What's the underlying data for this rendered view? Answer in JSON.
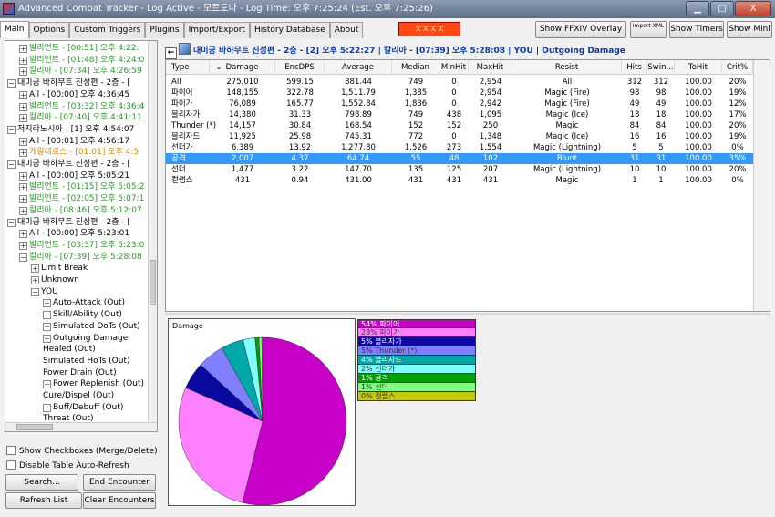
{
  "window": {
    "title": "Advanced Combat Tracker - Log Active - 모르도나 - Log Time: 오후 7:25:24 (Est. 오후 7:25:26)",
    "min": "▁",
    "max": "□",
    "close": "X"
  },
  "tabs": [
    "Main",
    "Options",
    "Custom Triggers",
    "Plugins",
    "Import/Export",
    "History Database",
    "About"
  ],
  "alert_text": "ㅈㅈㅈㅈ",
  "toolbar": {
    "overlay": "Show FFXIV Overlay",
    "import": "Import XML",
    "timers": "Show Timers",
    "mini": "Show Mini"
  },
  "tree": [
    {
      "text": "발리언트 - [00:51] 오후 4:22:",
      "cls": "g",
      "ind": 1,
      "box": "+"
    },
    {
      "text": "발리언트 - [01:48] 오후 4:24:0",
      "cls": "g",
      "ind": 1,
      "box": "+"
    },
    {
      "text": "칼리아 - [07:34] 오후 4:26:59",
      "cls": "g",
      "ind": 1,
      "box": "+"
    },
    {
      "text": "대미궁 바하무트 진성편 - 2층 - [",
      "cls": "",
      "ind": 0,
      "box": "−"
    },
    {
      "text": "All - [00:00] 오후 4:36:45",
      "cls": "",
      "ind": 1,
      "box": "+"
    },
    {
      "text": "발리언트 - [03:32] 오후 4:36:4",
      "cls": "g",
      "ind": 1,
      "box": "+"
    },
    {
      "text": "칼리아 - [07:40] 오후 4:41:11",
      "cls": "g",
      "ind": 1,
      "box": "+"
    },
    {
      "text": "저지라노시아 - [1] 오후 4:54:07",
      "cls": "",
      "ind": 0,
      "box": "−"
    },
    {
      "text": "All - [00:01] 오후 4:56:17",
      "cls": "",
      "ind": 1,
      "box": "+"
    },
    {
      "text": "게릴레로스 - [01:01] 오후 4:5",
      "cls": "o",
      "ind": 1,
      "box": "+"
    },
    {
      "text": "대미궁 바하무트 진성편 - 2층 - [",
      "cls": "",
      "ind": 0,
      "box": "−"
    },
    {
      "text": "All - [00:00] 오후 5:05:21",
      "cls": "",
      "ind": 1,
      "box": "+"
    },
    {
      "text": "발리언트 - [01:15] 오후 5:05:2",
      "cls": "g",
      "ind": 1,
      "box": "+"
    },
    {
      "text": "발리언트 - [02:05] 오후 5:07:1",
      "cls": "g",
      "ind": 1,
      "box": "+"
    },
    {
      "text": "칼리아 - [08:46] 오후 5:12:07",
      "cls": "g",
      "ind": 1,
      "box": "+"
    },
    {
      "text": "대미궁 바하무트 진성편 - 2층 - [",
      "cls": "",
      "ind": 0,
      "box": "−"
    },
    {
      "text": "All - [00:00] 오후 5:23:01",
      "cls": "",
      "ind": 1,
      "box": "+"
    },
    {
      "text": "발리언트 - [03:37] 오후 5:23:0",
      "cls": "g",
      "ind": 1,
      "box": "+"
    },
    {
      "text": "칼리아 - [07:39] 오후 5:28:08",
      "cls": "g",
      "ind": 1,
      "box": "−"
    },
    {
      "text": "Limit Break",
      "cls": "",
      "ind": 2,
      "box": "+"
    },
    {
      "text": "Unknown",
      "cls": "",
      "ind": 2,
      "box": "+"
    },
    {
      "text": "YOU",
      "cls": "",
      "ind": 2,
      "box": "−"
    },
    {
      "text": "Auto-Attack (Out)",
      "cls": "",
      "ind": 3,
      "box": "+"
    },
    {
      "text": "Skill/Ability (Out)",
      "cls": "",
      "ind": 3,
      "box": "+"
    },
    {
      "text": "Simulated DoTs (Out)",
      "cls": "",
      "ind": 3,
      "box": "+"
    },
    {
      "text": "Outgoing Damage",
      "cls": "",
      "ind": 3,
      "box": "+"
    },
    {
      "text": "Healed (Out)",
      "cls": "",
      "ind": 3,
      "box": ""
    },
    {
      "text": "Simulated HoTs (Out)",
      "cls": "",
      "ind": 3,
      "box": ""
    },
    {
      "text": "Power Drain (Out)",
      "cls": "",
      "ind": 3,
      "box": ""
    },
    {
      "text": "Power Replenish (Out)",
      "cls": "",
      "ind": 3,
      "box": "+"
    },
    {
      "text": "Cure/Dispel (Out)",
      "cls": "",
      "ind": 3,
      "box": ""
    },
    {
      "text": "Buff/Debuff (Out)",
      "cls": "",
      "ind": 3,
      "box": "+"
    },
    {
      "text": "Threat (Out)",
      "cls": "",
      "ind": 3,
      "box": ""
    }
  ],
  "options": {
    "checkboxes": "Show Checkboxes (Merge/Delete)",
    "auto_refresh": "Disable Table Auto-Refresh"
  },
  "buttons": {
    "search": "Search...",
    "end": "End Encounter",
    "refresh": "Refresh List",
    "clear": "Clear Encounters"
  },
  "header_text": "대미궁 바하무트 진성편 - 2층 - [2] 오후 5:22:27  |  칼리아 - [07:39] 오후 5:28:08  |  YOU  |  Outgoing Damage",
  "table": {
    "columns": [
      "Type",
      "Damage",
      "EncDPS",
      "Average",
      "Median",
      "MinHit",
      "MaxHit",
      "Resist",
      "Hits",
      "Swin...",
      "ToHit",
      "Crit%"
    ],
    "sort_indicator": "⌄",
    "rows": [
      [
        "All",
        "275,010",
        "599.15",
        "881.44",
        "749",
        "0",
        "2,954",
        "All",
        "312",
        "312",
        "100.00",
        "20%"
      ],
      [
        "파이어",
        "148,155",
        "322.78",
        "1,511.79",
        "1,385",
        "0",
        "2,954",
        "Magic (Fire)",
        "98",
        "98",
        "100.00",
        "19%"
      ],
      [
        "파이가",
        "76,089",
        "165.77",
        "1,552.84",
        "1,836",
        "0",
        "2,942",
        "Magic (Fire)",
        "49",
        "49",
        "100.00",
        "12%"
      ],
      [
        "블리자가",
        "14,380",
        "31.33",
        "798.89",
        "749",
        "438",
        "1,095",
        "Magic (Ice)",
        "18",
        "18",
        "100.00",
        "17%"
      ],
      [
        "Thunder (*)",
        "14,157",
        "30.84",
        "168.54",
        "152",
        "152",
        "250",
        "Magic",
        "84",
        "84",
        "100.00",
        "20%"
      ],
      [
        "블리자드",
        "11,925",
        "25.98",
        "745.31",
        "772",
        "0",
        "1,348",
        "Magic (Ice)",
        "16",
        "16",
        "100.00",
        "19%"
      ],
      [
        "선더가",
        "6,389",
        "13.92",
        "1,277.80",
        "1,526",
        "273",
        "1,554",
        "Magic (Lightning)",
        "5",
        "5",
        "100.00",
        "0%"
      ],
      [
        "공격",
        "2,007",
        "4.37",
        "64.74",
        "55",
        "48",
        "102",
        "Blunt",
        "31",
        "31",
        "100.00",
        "35%"
      ],
      [
        "선더",
        "1,477",
        "3.22",
        "147.70",
        "135",
        "125",
        "207",
        "Magic (Lightning)",
        "10",
        "10",
        "100.00",
        "20%"
      ],
      [
        "컬랩스",
        "431",
        "0.94",
        "431.00",
        "431",
        "431",
        "431",
        "Magic",
        "1",
        "1",
        "100.00",
        "0%"
      ]
    ],
    "selected_row": 7
  },
  "chart_data": {
    "type": "pie",
    "title": "Damage",
    "slices": [
      {
        "label": "파이어",
        "pct_text": "54%",
        "value": 148155,
        "color": "#c800c8"
      },
      {
        "label": "파이가",
        "pct_text": "28%",
        "value": 76089,
        "color": "#ff80ff"
      },
      {
        "label": "블리자가",
        "pct_text": "5%",
        "value": 14380,
        "color": "#0a0aa0"
      },
      {
        "label": "Thunder (*)",
        "pct_text": "5%",
        "value": 14157,
        "color": "#8080ff"
      },
      {
        "label": "블리자드",
        "pct_text": "4%",
        "value": 11925,
        "color": "#00a8a8"
      },
      {
        "label": "선더가",
        "pct_text": "2%",
        "value": 6389,
        "color": "#80ffff"
      },
      {
        "label": "공격",
        "pct_text": "1%",
        "value": 2007,
        "color": "#00a000"
      },
      {
        "label": "선더",
        "pct_text": "1%",
        "value": 1477,
        "color": "#80ff80"
      },
      {
        "label": "컬랩스",
        "pct_text": "0%",
        "value": 431,
        "color": "#c8c800"
      }
    ]
  }
}
